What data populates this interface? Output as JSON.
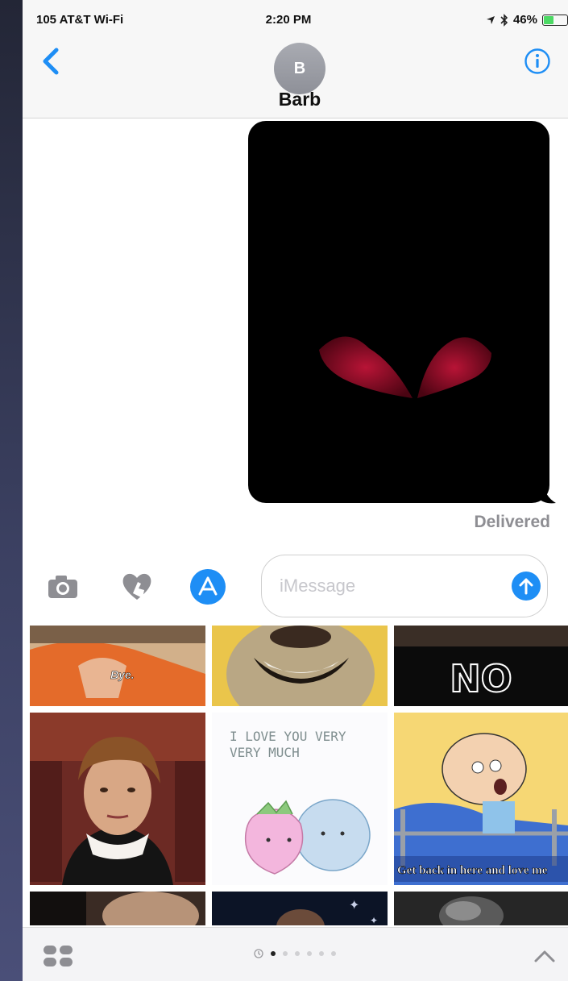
{
  "status_bar": {
    "carrier": "105 AT&T Wi-Fi",
    "time": "2:20 PM",
    "battery": "46%",
    "battery_level": 0.46
  },
  "nav": {
    "back_icon": "chevron-left-icon",
    "contact_initial": "B",
    "contact_name": "Barb",
    "info_icon": "info-icon"
  },
  "thread": {
    "message_type": "image",
    "status": "Delivered"
  },
  "composer": {
    "camera_icon": "camera-icon",
    "digital_touch_icon": "heart-hand-icon",
    "app_store_icon": "app-store-icon",
    "placeholder": "iMessage",
    "send_icon": "send-arrow-icon"
  },
  "gif_picker": {
    "items": [
      {
        "caption": "Bye."
      },
      {
        "caption": ""
      },
      {
        "caption": "NO"
      },
      {
        "caption": ""
      },
      {
        "caption": "I LOVE YOU VERY VERY MUCH"
      },
      {
        "caption": "Get back in here and love me"
      },
      {
        "caption": ""
      },
      {
        "caption": ""
      },
      {
        "caption": ""
      }
    ]
  },
  "bottom_bar": {
    "apps_icon": "app-drawer-icon",
    "page_count": 6,
    "active_page": 1,
    "collapse_icon": "chevron-up-icon"
  },
  "colors": {
    "accent": "#1e8ef5",
    "delivered": "#8e8e93"
  }
}
